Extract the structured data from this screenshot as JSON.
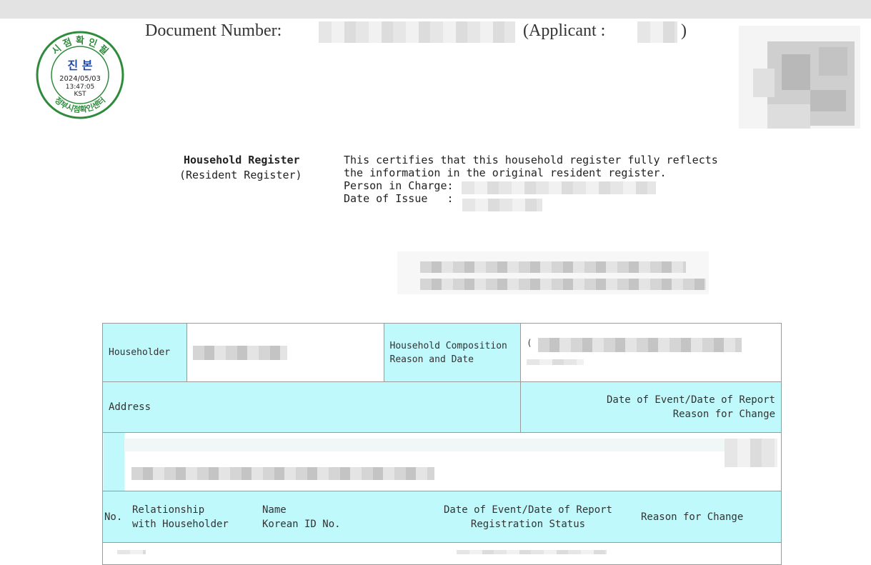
{
  "header": {
    "document_number_label": "Document Number:",
    "applicant_label": "(Applicant :",
    "applicant_close": ")"
  },
  "stamp": {
    "top_text": "시 점 확 인 필",
    "center_text": "진 본",
    "date": "2024/05/03",
    "time": "13:47:05",
    "zone": "KST",
    "bottom_text": "정부시점확인센터",
    "color": "#2e8b3c",
    "text_color": "#1f4aa8"
  },
  "register": {
    "title": "Household Register",
    "subtitle": "(Resident Register)",
    "cert_line1": "This certifies that this household register fully reflects",
    "cert_line2": "the information in the original resident register.",
    "person_label": "Person in Charge:",
    "date_label": "Date of Issue   :"
  },
  "table": {
    "householder_label": "Householder",
    "composition_label_1": "Household Composition",
    "composition_label_2": "Reason and Date",
    "composition_paren": "(",
    "address_label": "Address",
    "event_label_1": "Date of Event/Date of Report",
    "event_label_2": "Reason for Change",
    "col_no": "No.",
    "col_relationship_1": "Relationship",
    "col_relationship_2": "with Householder",
    "col_name_1": "Name",
    "col_name_2": "Korean ID No.",
    "col_event_1": "Date of Event/Date of Report",
    "col_event_2": "Registration Status",
    "col_reason": "Reason for Change"
  },
  "colors": {
    "header_cyan": "#bff9fb",
    "topbar": "#e3e3e3"
  }
}
